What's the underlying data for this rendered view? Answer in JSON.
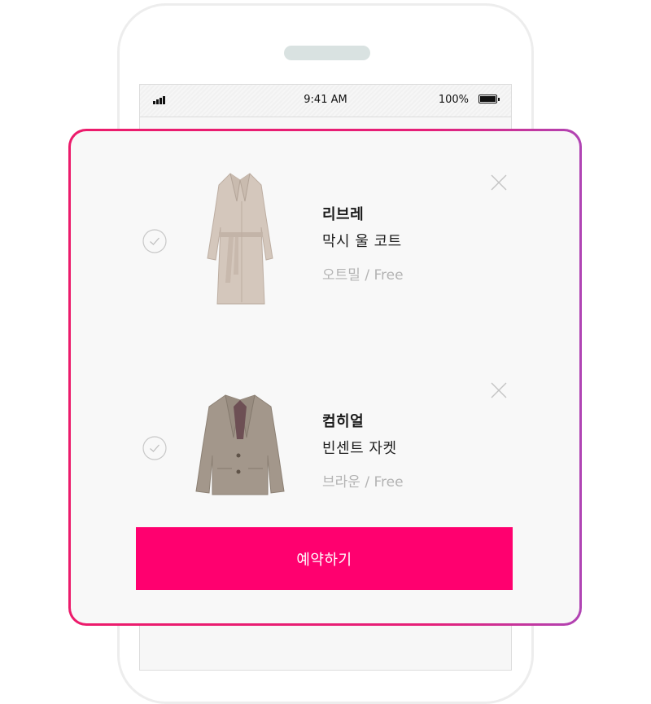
{
  "status_bar": {
    "time": "9:41 AM",
    "battery": "100%"
  },
  "cart": {
    "items": [
      {
        "brand": "리브레",
        "name": "막시 울 코트",
        "option": "오트밀 / Free",
        "image": "coat",
        "image_color": "#d4c7bc"
      },
      {
        "brand": "컴히얼",
        "name": "빈센트 자켓",
        "option": "브라운 / Free",
        "image": "jacket",
        "image_color": "#a3978b"
      }
    ],
    "reserve_label": "예약하기"
  },
  "colors": {
    "accent": "#ff006f",
    "border_gradient": [
      "#ec1b6b",
      "#b044b4"
    ],
    "muted_text": "#b3b3b3"
  },
  "icons": [
    "signal-icon",
    "battery-icon",
    "check-icon",
    "close-icon"
  ]
}
